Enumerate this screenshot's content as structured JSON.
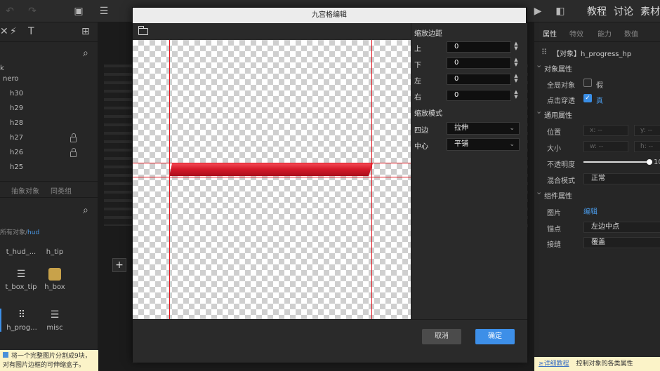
{
  "topbar": {
    "tabs": [
      "教程",
      "讨论",
      "素材"
    ]
  },
  "left_panel": {
    "tree": [
      "k",
      "nero",
      "h30",
      "h29",
      "h28",
      "h27",
      "h26",
      "h25"
    ],
    "tabs": [
      "抽象对象",
      "同类组"
    ],
    "path_prefix": "所有对象/",
    "path_current": "hud",
    "assets": [
      "t_hud_...",
      "h_tip",
      "t_box_tip",
      "h_box",
      "h_prog...",
      "misc"
    ],
    "tip": "将一个完整图片分割成9块，\n对有图片边框的可伸缩盒子。"
  },
  "modal": {
    "title": "九宫格编辑",
    "settings": {
      "margin_title": "缩放边距",
      "top_label": "上",
      "top_value": "0",
      "bottom_label": "下",
      "bottom_value": "0",
      "left_label": "左",
      "left_value": "0",
      "right_label": "右",
      "right_value": "0",
      "mode_title": "缩放模式",
      "edge_label": "四边",
      "edge_value": "拉伸",
      "center_label": "中心",
      "center_value": "平铺"
    },
    "cancel_label": "取消",
    "ok_label": "确定"
  },
  "right_panel": {
    "tabs": [
      "属性",
      "特效",
      "能力",
      "数值"
    ],
    "object_name": "【对象】h_progress_hp",
    "section_object": "对象属性",
    "global_label": "全局对象",
    "global_value": "假",
    "click_label": "点击穿透",
    "click_value": "真",
    "section_common": "通用属性",
    "position_label": "位置",
    "pos_x": "x: --",
    "pos_y": "y: --",
    "size_label": "大小",
    "size_w": "w: --",
    "size_h": "h: --",
    "opacity_label": "不透明度",
    "opacity_value": "10",
    "blend_label": "混合模式",
    "blend_value": "正常",
    "section_component": "组件属性",
    "image_label": "图片",
    "image_value": "编辑",
    "anchor_label": "锚点",
    "anchor_value": "左边中点",
    "overflow_label": "接缝",
    "overflow_value": "覆盖",
    "help_link": "≥详细教程",
    "help_text": "控制对象的各类属性"
  },
  "colors": {
    "accent": "#3d8fe8",
    "guide": "#e0141e",
    "bar": "#d61a2a"
  }
}
